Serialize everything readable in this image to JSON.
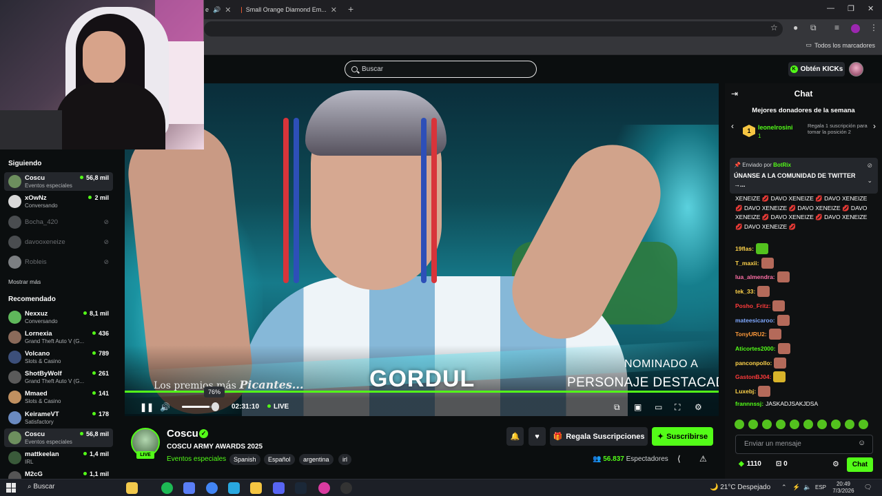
{
  "browser": {
    "tabs": [
      {
        "title": "e"
      },
      {
        "title": "Small Orange Diamond Em..."
      }
    ],
    "bookmarks_folder": "Todos los marcadores"
  },
  "header": {
    "search_placeholder": "Buscar",
    "kicks_button": "Obtén KICKs"
  },
  "sidebar": {
    "following_heading": "Siguiendo",
    "following": [
      {
        "name": "Coscu",
        "sub": "Eventos especiales",
        "viewers": "56,8 mil",
        "live": true,
        "active": true,
        "avatar_color": "#6d8f5e"
      },
      {
        "name": "xOwNz",
        "sub": "Conversando",
        "viewers": "2 mil",
        "live": true,
        "active": false,
        "avatar_color": "#d9d9d9"
      },
      {
        "name": "Bocha_420",
        "sub": "",
        "viewers": "",
        "live": false,
        "active": false,
        "avatar_color": "#4a4d50"
      },
      {
        "name": "davooxeneize",
        "sub": "",
        "viewers": "",
        "live": false,
        "active": false,
        "avatar_color": "#4a4d50"
      },
      {
        "name": "Robleis",
        "sub": "",
        "viewers": "",
        "live": false,
        "active": false,
        "avatar_color": "#7c7f82"
      }
    ],
    "show_more": "Mostrar más",
    "recommended_heading": "Recomendado",
    "recommended": [
      {
        "name": "Nexxuz",
        "sub": "Conversando",
        "viewers": "8,1 mil",
        "avatar_color": "#5fb85b"
      },
      {
        "name": "Lornexia",
        "sub": "Grand Theft Auto V (G...",
        "viewers": "436",
        "avatar_color": "#8a6a5a"
      },
      {
        "name": "Volcano",
        "sub": "Slots & Casino",
        "viewers": "789",
        "avatar_color": "#3c4f7a"
      },
      {
        "name": "ShotByWolf",
        "sub": "Grand Theft Auto V (G...",
        "viewers": "261",
        "avatar_color": "#5a5a5a"
      },
      {
        "name": "Mmaed",
        "sub": "Slots & Casino",
        "viewers": "141",
        "avatar_color": "#c09060"
      },
      {
        "name": "KeirameVT",
        "sub": "Satisfactory",
        "viewers": "178",
        "avatar_color": "#6a8ac0"
      },
      {
        "name": "Coscu",
        "sub": "Eventos especiales",
        "viewers": "56,8 mil",
        "avatar_color": "#6d8f5e",
        "active": true
      },
      {
        "name": "mattkeelan",
        "sub": "IRL",
        "viewers": "1,4 mil",
        "avatar_color": "#3a5a3a"
      },
      {
        "name": "M2cG",
        "sub": "",
        "viewers": "1,1 mil",
        "avatar_color": "#555"
      }
    ]
  },
  "video": {
    "overlay_premios_prefix": "Los premios más ",
    "overlay_premios_em": "Picantes...",
    "overlay_name": "GORDUL",
    "overlay_nominado": "NOMINADO A",
    "overlay_personaje": "PERSONAJE DESTACADO",
    "volume_percent": 76,
    "volume_label": "76%",
    "time": "02:31:10",
    "live_label": "LIVE"
  },
  "stream": {
    "channel": "Coscu",
    "live_badge": "LIVE",
    "title": "COSCU ARMY AWARDS 2025",
    "category": "Eventos especiales",
    "tags": [
      "Spanish",
      "Español",
      "argentina",
      "irl"
    ],
    "gift_button": "Regala Suscripciones",
    "subscribe_button": "Suscribirse",
    "viewers_count": "56.837",
    "viewers_label": "Espectadores"
  },
  "chat": {
    "title": "Chat",
    "donors_title": "Mejores donadores de la semana",
    "donor": {
      "rank": "1",
      "name": "leonelrosini",
      "count": "1"
    },
    "donor_promo": "Regala 1 suscripción para tomar la posición 2",
    "pinned_by_prefix": "Enviado por",
    "pinned_by_user": "BotRix",
    "pinned_text": "ÚNANSE A LA COMUNIDAD DE TWITTER →...",
    "spam_text": "XENEIZE 💋 DAVO XENEIZE 💋 DAVO XENEIZE 💋 DAVO XENEIZE 💋 DAVO XENEIZE 💋 DAVO XENEIZE 💋 DAVO XENEIZE 💋 DAVO XENEIZE 💋 DAVO XENEIZE 💋",
    "messages": [
      {
        "user": "19flas:",
        "color": "#ffd34a",
        "text": "",
        "emote": "#53c21e"
      },
      {
        "user": "T_maxii:",
        "color": "#ffd34a",
        "text": "",
        "emote": "#b46a5a"
      },
      {
        "user": "lua_almendra:",
        "color": "#ff6fa6",
        "text": "",
        "emote": "#b46a5a"
      },
      {
        "user": "tek_33:",
        "color": "#ffd34a",
        "text": "",
        "emote": "#b46a5a"
      },
      {
        "user": "Posho_Fritz:",
        "color": "#ff3b3b",
        "text": "",
        "emote": "#b46a5a"
      },
      {
        "user": "mateesicaroo:",
        "color": "#7fa8ff",
        "text": "",
        "emote": "#b46a5a"
      },
      {
        "user": "TonyURU2:",
        "color": "#ff9a3b",
        "text": "",
        "emote": "#b46a5a"
      },
      {
        "user": "Aticortes2000:",
        "color": "#53fc18",
        "text": "",
        "emote": "#b46a5a"
      },
      {
        "user": "panconpollo:",
        "color": "#ffd34a",
        "text": "",
        "emote": "#b46a5a"
      },
      {
        "user": "GastonBJ04:",
        "color": "#ff3b3b",
        "text": "",
        "emote": "#d8b32a"
      },
      {
        "user": "Luxebj:",
        "color": "#ffd34a",
        "text": "",
        "emote": "#b46a5a"
      },
      {
        "user": "frannnssj:",
        "color": "#53fc18",
        "text": "JASKADJSAKJDSA",
        "emote": ""
      }
    ],
    "input_placeholder": "Enviar un mensaje",
    "kicks_count": "1110",
    "points_count": "0",
    "send_button": "Chat"
  },
  "taskbar": {
    "search": "Buscar",
    "weather": "21°C  Despejado",
    "lang": "ESP",
    "time": "20:49",
    "date": "7/3/2026"
  }
}
